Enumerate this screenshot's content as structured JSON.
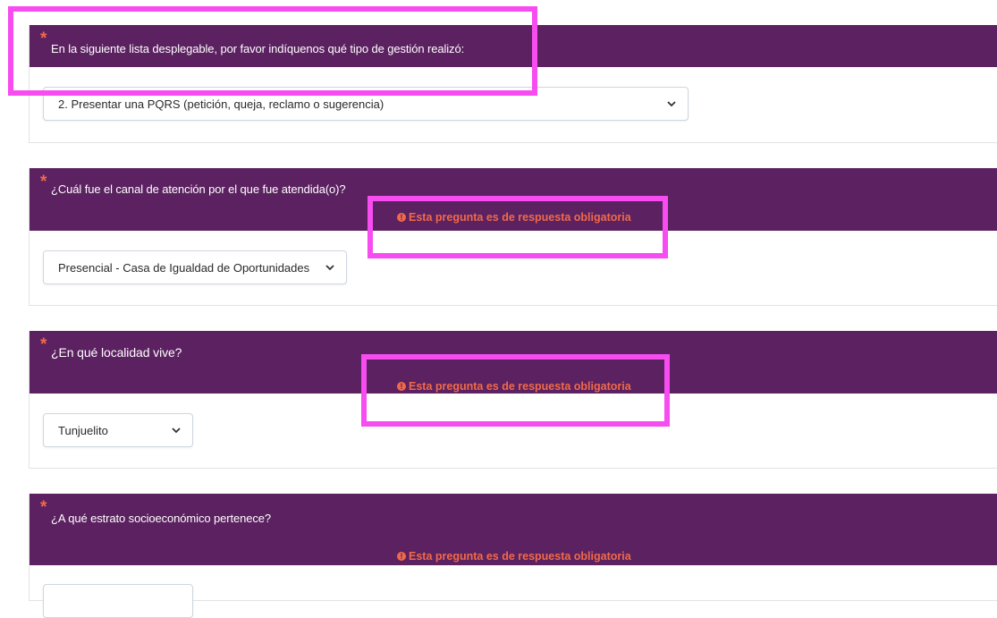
{
  "questions": [
    {
      "text": "En la siguiente lista desplegable, por favor indíquenos qué tipo de gestión realizó:",
      "selected": "2. Presentar una PQRS (petición, queja, reclamo o sugerencia)",
      "error": ""
    },
    {
      "text": "¿Cuál fue el canal de atención por el que fue atendida(o)?",
      "selected": "Presencial - Casa de Igualdad de Oportunidades",
      "error": "Esta pregunta es de respuesta obligatoria"
    },
    {
      "text": "¿En qué localidad vive?",
      "selected": "Tunjuelito",
      "error": "Esta pregunta es de respuesta obligatoria"
    },
    {
      "text": "¿A qué estrato socioeconómico pertenece?",
      "selected": "",
      "error": "Esta pregunta es de respuesta obligatoria"
    }
  ],
  "required_marker": "*",
  "error_icon": "!",
  "colors": {
    "header_bg": "#5b2160",
    "error": "#f06a4a",
    "highlight": "#f74cf0"
  },
  "icons": {
    "select_arrow": "chevron-down-icon",
    "error": "exclamation-circle-icon"
  }
}
